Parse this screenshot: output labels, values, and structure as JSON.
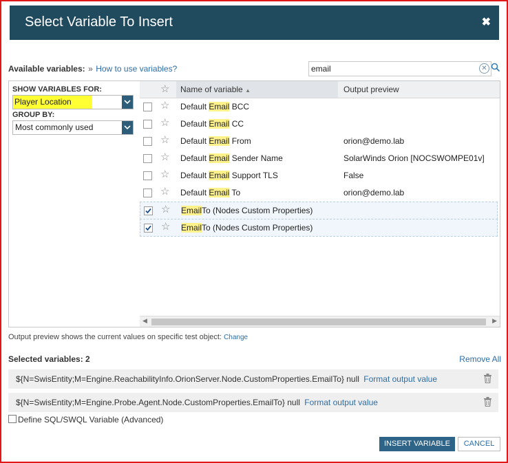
{
  "dialog": {
    "title": "Select Variable To Insert",
    "close_glyph": "✖"
  },
  "available": {
    "label": "Available variables:",
    "separator": "»",
    "help_link": "How to use variables?"
  },
  "search": {
    "value": "email",
    "clear_glyph": "✕"
  },
  "left": {
    "show_for_label": "SHOW VARIABLES FOR:",
    "show_for_value": "Player Location",
    "group_by_label": "GROUP BY:",
    "group_by_value": "Most commonly used",
    "dropdown_glyph": "⌄"
  },
  "grid": {
    "columns": {
      "star_glyph": "☆",
      "name": "Name of variable",
      "sort_glyph": "▲",
      "preview": "Output preview"
    },
    "rows": [
      {
        "pre": "Default ",
        "match": "Email",
        "post": " BCC",
        "preview": "",
        "checked": false
      },
      {
        "pre": "Default ",
        "match": "Email",
        "post": " CC",
        "preview": "",
        "checked": false
      },
      {
        "pre": "Default ",
        "match": "Email",
        "post": " From",
        "preview": "orion@demo.lab",
        "checked": false
      },
      {
        "pre": "Default ",
        "match": "Email",
        "post": " Sender Name",
        "preview": "SolarWinds Orion [NOCSWOMPE01v]",
        "checked": false
      },
      {
        "pre": "Default ",
        "match": "Email",
        "post": " Support TLS",
        "preview": "False",
        "checked": false
      },
      {
        "pre": "Default ",
        "match": "Email",
        "post": " To",
        "preview": "orion@demo.lab",
        "checked": false
      },
      {
        "pre": "",
        "match": "Email",
        "post": "To (Nodes Custom Properties)",
        "preview": "",
        "checked": true
      },
      {
        "pre": "",
        "match": "Email",
        "post": "To (Nodes Custom Properties)",
        "preview": "",
        "checked": true
      }
    ],
    "scroll_left": "◀",
    "scroll_right": "▶"
  },
  "output_preview": {
    "text": "Output preview shows the current values on specific test object:",
    "change": "Change"
  },
  "selected": {
    "label": "Selected variables: 2",
    "remove_all": "Remove All",
    "items": [
      {
        "expr": "${N=SwisEntity;M=Engine.ReachabilityInfo.OrionServer.Node.CustomProperties.EmailTo}",
        "value": "null",
        "format": "Format output value"
      },
      {
        "expr": "${N=SwisEntity;M=Engine.Probe.Agent.Node.CustomProperties.EmailTo}",
        "value": "null",
        "format": "Format output value"
      }
    ]
  },
  "define_label": "Define SQL/SWQL Variable (Advanced)",
  "buttons": {
    "insert": "INSERT VARIABLE",
    "cancel": "CANCEL"
  },
  "colors": {
    "header_bg": "#204a5e",
    "primary_button": "#2d6488",
    "link": "#2b6ea8",
    "highlight": "#fff28a",
    "frame": "#e01818"
  }
}
